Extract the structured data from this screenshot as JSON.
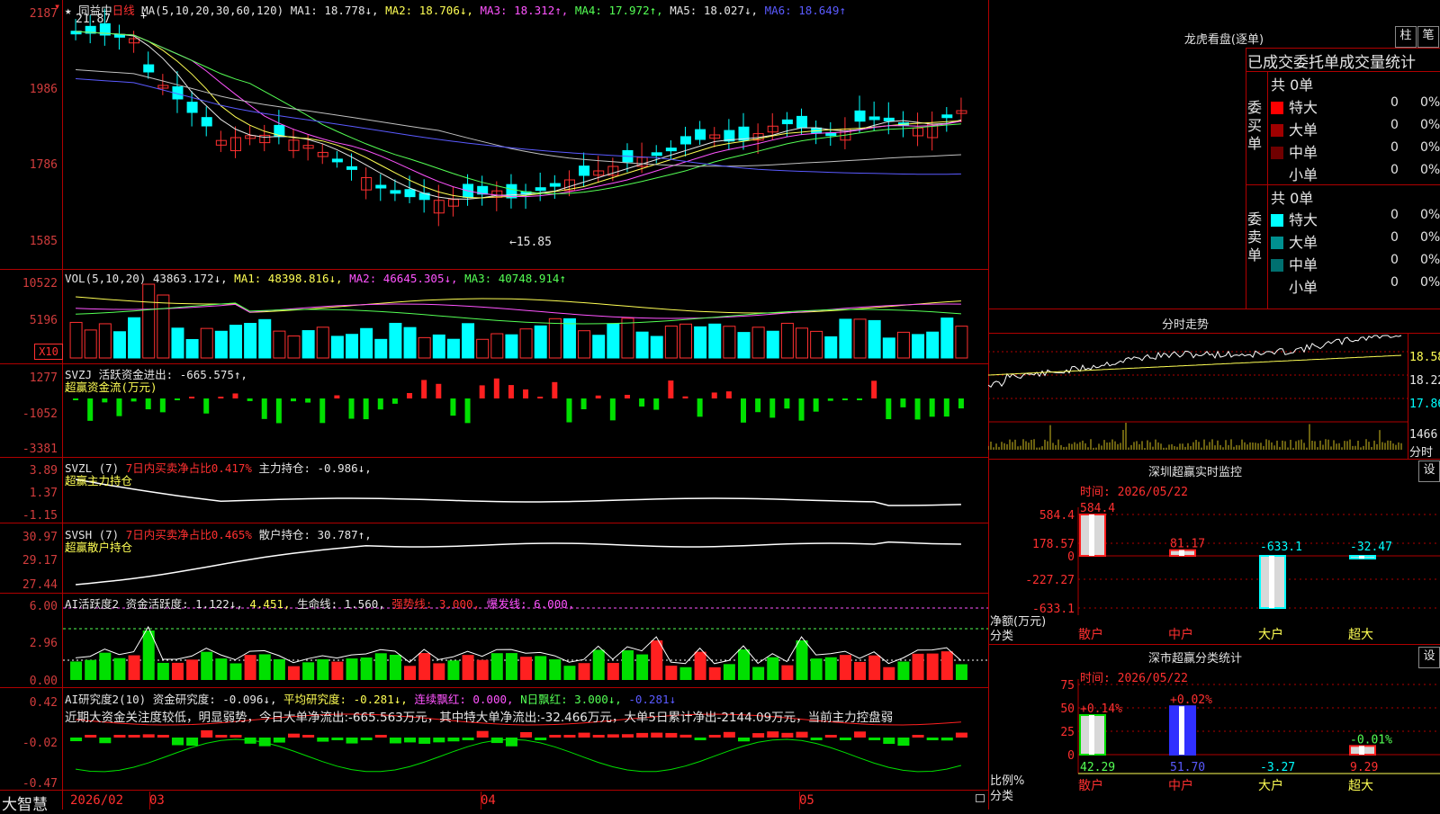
{
  "main": {
    "stock_name": "同益中",
    "period": "日线",
    "ma_label": "MA(5,10,20,30,60,120)",
    "ma1": "MA1: 18.778↓,",
    "ma2": "MA2: 18.706↓,",
    "ma3": "MA3: 18.312↑,",
    "ma4": "MA4: 17.972↑,",
    "ma5": "MA5: 18.027↓,",
    "ma6": "MA6: 18.649↑",
    "high_label": "21.87",
    "low_label": "←15.85",
    "y_ticks": [
      "2187",
      "1986",
      "1786",
      "1585"
    ]
  },
  "vol": {
    "label": "VOL(5,10,20)",
    "value": "43863.172↓,",
    "ma1": "MA1: 48398.816↓,",
    "ma2": "MA2: 46645.305↓,",
    "ma3": "MA3: 40748.914↑",
    "y_ticks": [
      "10522",
      "5196"
    ],
    "unit": "X10"
  },
  "svzj": {
    "label": "SVZJ",
    "text": "活跃资金进出: -665.575↑,",
    "sub": "超赢资金流(万元)",
    "y_ticks": [
      "1277",
      "-1052",
      "-3381"
    ]
  },
  "svzl": {
    "label": "SVZL (7)",
    "t1": "7日内买卖净占比0.417%",
    "t2": "主力持仓: -0.986↓,",
    "sub": "超赢主力持仓",
    "y_ticks": [
      "3.89",
      "1.37",
      "-1.15"
    ]
  },
  "svsh": {
    "label": "SVSH (7)",
    "t1": "7日内买卖净占比0.465%",
    "t2": "散户持仓: 30.787↑,",
    "sub": "超赢散户持仓",
    "y_ticks": [
      "30.97",
      "29.17",
      "27.44"
    ]
  },
  "ai1": {
    "label": "AI活跃度2",
    "t1": "资金活跃度: 1.122↓,",
    "t2": "4.451,",
    "t3": "生命线: 1.560,",
    "t4": "强势线: 3.000,",
    "t5": "爆发线: 6.000,",
    "y_ticks": [
      "6.00",
      "2.96",
      "0.00"
    ]
  },
  "ai2": {
    "label": "AI研究度2(10)",
    "t1": "资金研究度: -0.096↓,",
    "t2": "平均研究度: -0.281↓,",
    "t3": "连续飘红: 0.000,",
    "t4": "N日飘红: 3.000↓,",
    "t5": "-0.281↓",
    "commentary": "近期大资金关注度较低，明显弱势，今日大单净流出:-665.563万元，其中特大单净流出:-32.466万元，大单5日累计净出-2144.09万元，当前主力控盘弱",
    "y_ticks": [
      "0.42",
      "-0.02",
      "-0.47"
    ]
  },
  "bottom": {
    "brand": "大智慧",
    "dates": [
      "2026/02",
      "03",
      "04",
      "05"
    ]
  },
  "side": {
    "lhkp_title": "龙虎看盘(逐单)",
    "btn_zhu": "柱",
    "btn_bi": "笔",
    "tabs": "已成交委托单成交量统计",
    "buy_label": "委买单",
    "sell_label": "委卖单",
    "buy_total": "共 0单",
    "sell_total": "共 0单",
    "buy_rows": [
      {
        "name": "特大",
        "count": "0",
        "pct": "0%",
        "color": "#ff0000"
      },
      {
        "name": "大单",
        "count": "0",
        "pct": "0%",
        "color": "#a00000"
      },
      {
        "name": "中单",
        "count": "0",
        "pct": "0%",
        "color": "#700000"
      },
      {
        "name": "小单",
        "count": "0",
        "pct": "0%",
        "color": ""
      }
    ],
    "sell_rows": [
      {
        "name": "特大",
        "count": "0",
        "pct": "0%",
        "color": "#00ffff"
      },
      {
        "name": "大单",
        "count": "0",
        "pct": "0%",
        "color": "#009090"
      },
      {
        "name": "中单",
        "count": "0",
        "pct": "0%",
        "color": "#007070"
      },
      {
        "name": "小单",
        "count": "0",
        "pct": "0%",
        "color": ""
      }
    ],
    "fs_title": "分时走势",
    "fs_prices": [
      "18.58",
      "18.22",
      "17.86"
    ],
    "fs_vol": "1466",
    "fs_vol_label": "分时",
    "sz_title": "深圳超赢实时监控",
    "sz_btn": "设",
    "sz_time": "时间: 2026/05/22",
    "sz_y": [
      "584.4",
      "178.57",
      "0",
      "-227.27",
      "-633.1"
    ],
    "sz_ylabel": "净额(万元)",
    "sz_xlabel": "分类",
    "sz_values": [
      "584.4",
      "81.17",
      "-633.1",
      "-32.47"
    ],
    "sz_cats": [
      "散户",
      "中户",
      "大户",
      "超大"
    ],
    "ss_title": "深市超赢分类统计",
    "ss_btn": "设",
    "ss_time": "时间: 2026/05/22",
    "ss_y": [
      "75",
      "50",
      "25",
      "0"
    ],
    "ss_ylabel": "比例%",
    "ss_xlabel": "分类",
    "ss_top": [
      "+0.14%",
      "+0.02%",
      "",
      "-0.01%"
    ],
    "ss_bottom": [
      "42.29",
      "51.70",
      "-3.27",
      "9.29"
    ],
    "ss_cats": [
      "散户",
      "中户",
      "大户",
      "超大"
    ]
  }
}
